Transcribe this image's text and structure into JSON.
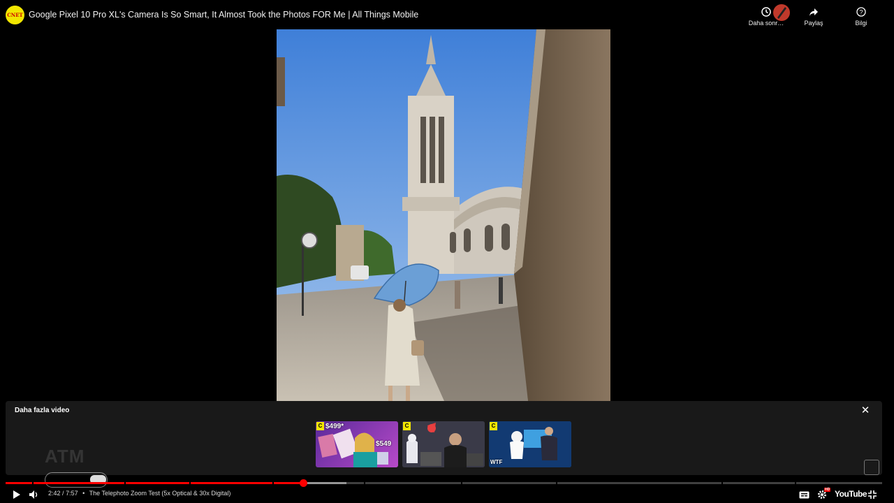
{
  "header": {
    "channel_logo_text": "CNET",
    "title": "Google Pixel 10 Pro XL's Camera Is So Smart, It Almost Took the Photos FOR Me | All Things Mobile",
    "actions": [
      {
        "label": "Daha sonr…",
        "icon": "clock-icon"
      },
      {
        "label": "Paylaş",
        "icon": "share-icon"
      },
      {
        "label": "Bilgi",
        "icon": "info-icon"
      }
    ]
  },
  "end_screen": {
    "title": "Daha fazla video",
    "close_icon": "close-icon",
    "watermark": "ATM",
    "thumbnails": [
      {
        "badge": "C",
        "price_a": "$499*",
        "price_b": "$549"
      },
      {
        "badge": "C"
      },
      {
        "badge": "C",
        "tag": "WTF"
      }
    ]
  },
  "player": {
    "current_time": "2:42",
    "duration": "7:57",
    "chapter": "The Telephoto Zoom Test (5x Optical & 30x Digital)",
    "time_separator": "/",
    "bullet": "•",
    "played_fraction": 0.3397,
    "loaded_fraction": 0.3885,
    "brand": "YouTube",
    "hd_badge": "HD"
  },
  "colors": {
    "progress": "#ff0000",
    "brand_yellow": "#f2e600"
  }
}
